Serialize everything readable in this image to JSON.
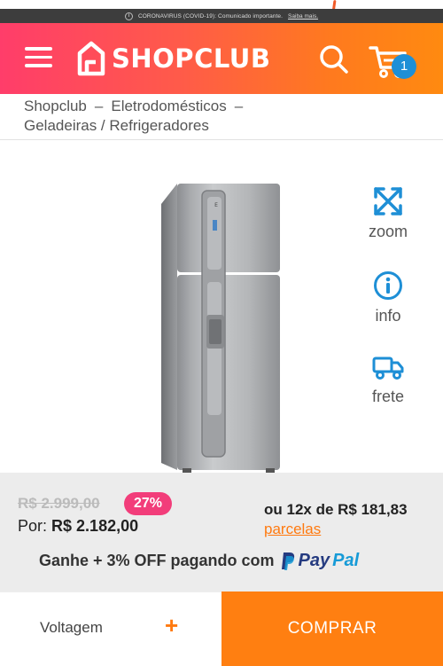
{
  "notice": {
    "text": "CORONAVIRUS (COVID-19): Comunicado importante.",
    "link": "Saiba mais."
  },
  "header": {
    "brand": "SHOPCLUB",
    "cart_count": "1",
    "colors": {
      "gradient_start": "#ff3d6a",
      "gradient_end": "#ff8a10",
      "badge": "#1e8fd6"
    }
  },
  "breadcrumb": {
    "items": [
      "Shopclub",
      "Eletrodomésticos",
      "Geladeiras / Refrigeradores"
    ],
    "separator": "–"
  },
  "side_actions": [
    {
      "icon": "zoom-icon",
      "label": "zoom"
    },
    {
      "icon": "info-icon",
      "label": "info"
    },
    {
      "icon": "truck-icon",
      "label": "frete"
    }
  ],
  "price": {
    "old": "R$ 2.999,00",
    "discount": "27%",
    "por_label": "Por:",
    "current": "R$ 2.182,00",
    "installments": "ou 12x de R$ 181,83",
    "installments_link": "parcelas"
  },
  "promo": {
    "text": "Ganhe + 3% OFF pagando com",
    "paypal_pay": "Pay",
    "paypal_pal": "Pal"
  },
  "bottom": {
    "voltage_label": "Voltagem",
    "voltage_action": "+",
    "buy_label": "COMPRAR"
  }
}
